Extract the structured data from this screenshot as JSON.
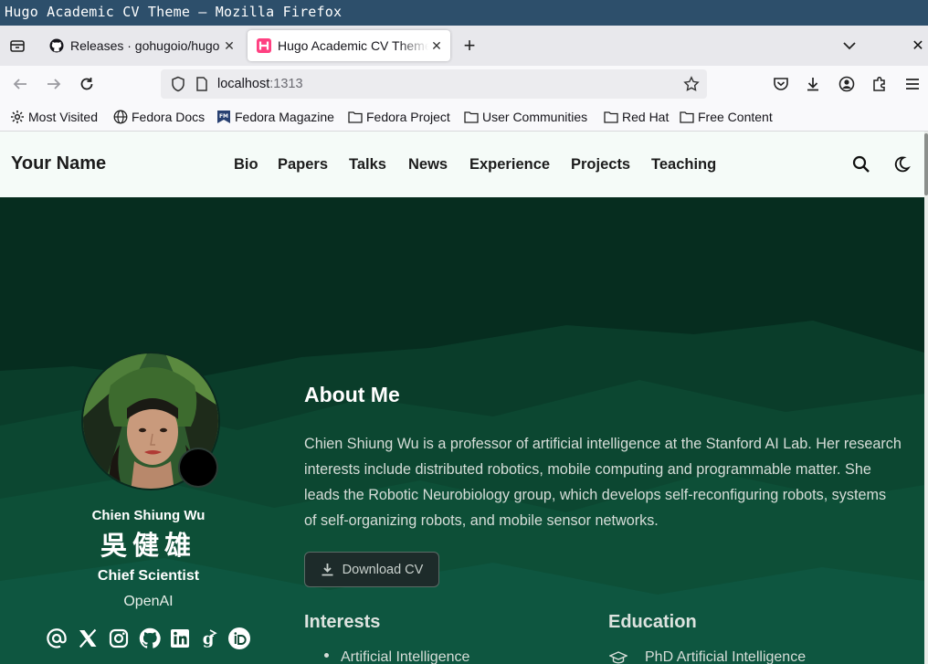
{
  "window": {
    "title": "Hugo Academic CV Theme — Mozilla Firefox"
  },
  "tabs": [
    {
      "title": "Releases · gohugoio/hugo",
      "favicon": "github-icon",
      "active": false
    },
    {
      "title": "Hugo Academic CV Theme",
      "favicon": "hugo-blox-icon",
      "active": true
    }
  ],
  "urlbar": {
    "host": "localhost",
    "port": ":1313"
  },
  "bookmarks": [
    {
      "label": "Most Visited",
      "icon": "gear-icon"
    },
    {
      "label": "Fedora Docs",
      "icon": "globe-icon"
    },
    {
      "label": "Fedora Magazine",
      "icon": "fedora-magazine-icon"
    },
    {
      "label": "Fedora Project",
      "icon": "folder-icon"
    },
    {
      "label": "User Communities",
      "icon": "folder-icon"
    },
    {
      "label": "Red Hat",
      "icon": "folder-icon"
    },
    {
      "label": "Free Content",
      "icon": "folder-icon"
    }
  ],
  "site": {
    "brand": "Your Name",
    "menu": [
      "Bio",
      "Papers",
      "Talks",
      "News",
      "Experience",
      "Projects",
      "Teaching"
    ]
  },
  "profile": {
    "name_en": "Chien Shiung Wu",
    "name_zh": "吳健雄",
    "role": "Chief Scientist",
    "organization": "OpenAI",
    "social_icons": [
      "at-email-icon",
      "x-twitter-icon",
      "instagram-icon",
      "github-icon",
      "linkedin-icon",
      "google-scholar-icon",
      "orcid-icon"
    ]
  },
  "about": {
    "title": "About Me",
    "text": "Chien Shiung Wu is a professor of artificial intelligence at the Stanford AI Lab. Her research interests include distributed robotics, mobile computing and programmable matter. She leads the Robotic Neurobiology group, which develops self-reconfiguring robots, systems of self-organizing robots, and mobile sensor networks.",
    "download_label": "Download CV"
  },
  "interests": {
    "title": "Interests",
    "items": [
      "Artificial Intelligence"
    ]
  },
  "education": {
    "title": "Education",
    "items": [
      "PhD Artificial Intelligence"
    ]
  },
  "colors": {
    "hero_bg": "#0c3326",
    "header_bg": "#f5fbf8",
    "titlebar": "#2d4f6b"
  }
}
